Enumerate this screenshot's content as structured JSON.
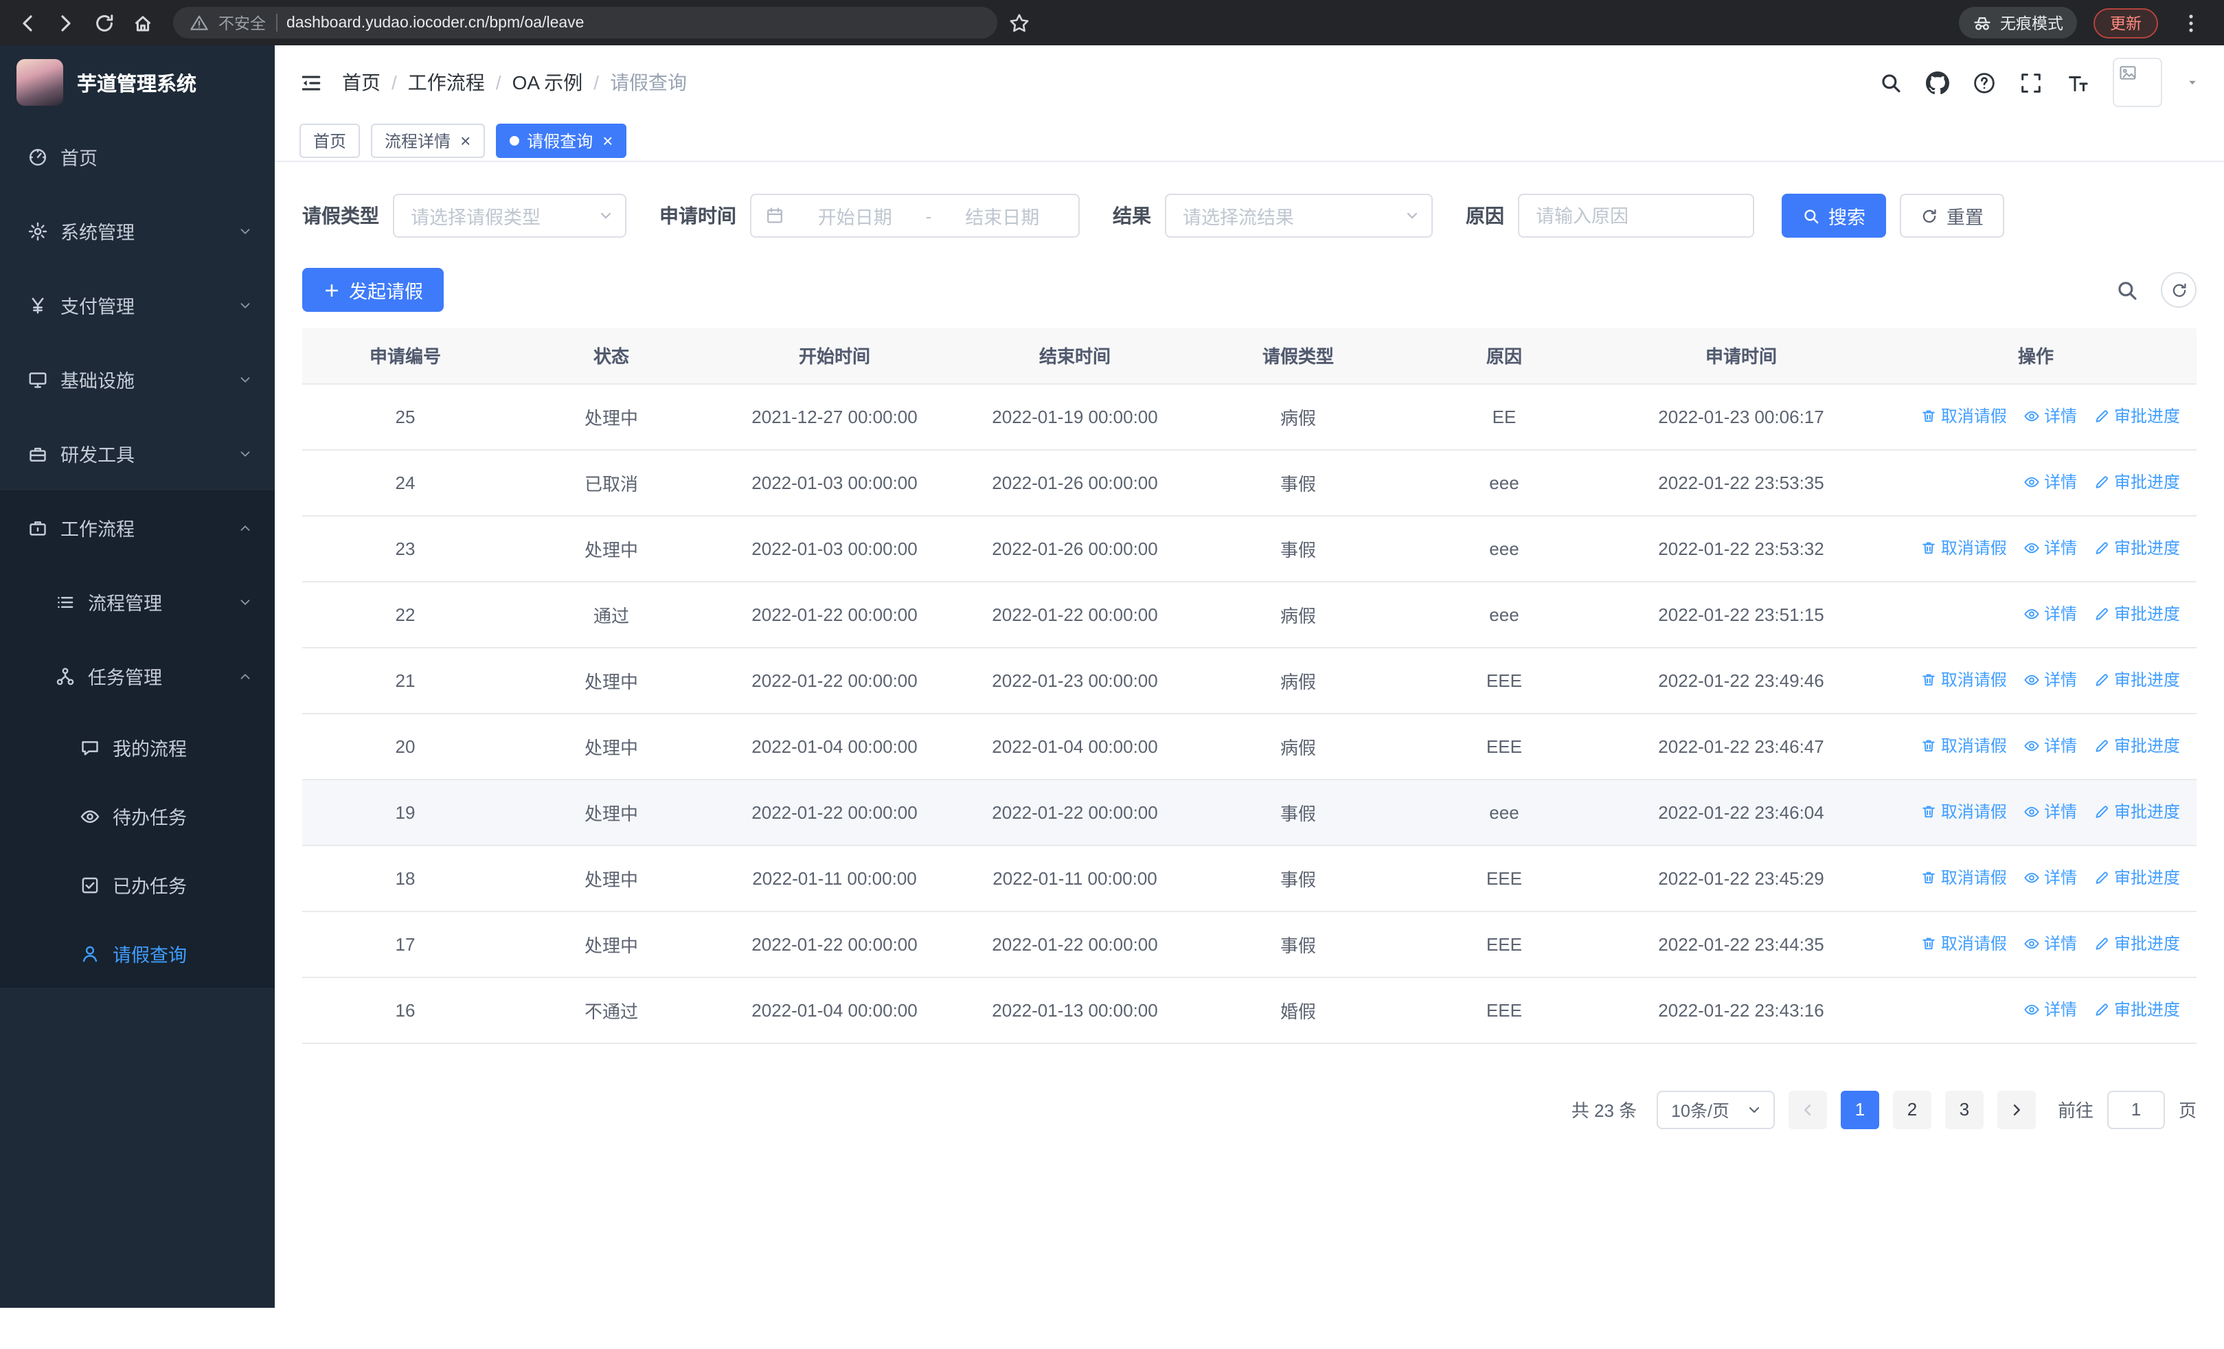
{
  "browser": {
    "security_warning": "不安全",
    "url": "dashboard.yudao.iocoder.cn/bpm/oa/leave",
    "incognito_label": "无痕模式",
    "update_label": "更新"
  },
  "sidebar": {
    "logo_title": "芋道管理系统",
    "menu": [
      {
        "key": "home",
        "icon": "dashboard",
        "label": "首页"
      },
      {
        "key": "system",
        "icon": "gear",
        "label": "系统管理",
        "arrow": "down"
      },
      {
        "key": "payment",
        "icon": "yen",
        "label": "支付管理",
        "arrow": "down"
      },
      {
        "key": "infrastructure",
        "icon": "infra",
        "label": "基础设施",
        "arrow": "down"
      },
      {
        "key": "devtools",
        "icon": "tools",
        "label": "研发工具",
        "arrow": "down"
      },
      {
        "key": "workflow",
        "icon": "workflow",
        "label": "工作流程",
        "arrow": "up",
        "open": true,
        "children": [
          {
            "key": "process-management",
            "icon": "process",
            "label": "流程管理",
            "arrow": "down"
          },
          {
            "key": "task-management",
            "icon": "org",
            "label": "任务管理",
            "arrow": "up",
            "open": true,
            "children": [
              {
                "key": "my-process",
                "icon": "chat",
                "label": "我的流程"
              },
              {
                "key": "todo-tasks",
                "icon": "eye",
                "label": "待办任务"
              },
              {
                "key": "done-tasks",
                "icon": "check-square",
                "label": "已办任务"
              },
              {
                "key": "leave-query",
                "icon": "user",
                "label": "请假查询",
                "active": true
              }
            ]
          }
        ]
      }
    ]
  },
  "header": {
    "breadcrumb": [
      "首页",
      "工作流程",
      "OA 示例",
      "请假查询"
    ],
    "separator": "/"
  },
  "tabs": [
    {
      "key": "home",
      "label": "首页",
      "closable": false,
      "active": false
    },
    {
      "key": "process-detail",
      "label": "流程详情",
      "closable": true,
      "active": false
    },
    {
      "key": "leave-query",
      "label": "请假查询",
      "closable": true,
      "active": true
    }
  ],
  "filters": {
    "leave_type_label": "请假类型",
    "leave_type_placeholder": "请选择请假类型",
    "apply_time_label": "申请时间",
    "start_date_placeholder": "开始日期",
    "range_separator": "-",
    "end_date_placeholder": "结束日期",
    "result_label": "结果",
    "result_placeholder": "请选择流结果",
    "reason_label": "原因",
    "reason_placeholder": "请输入原因",
    "search_button": "搜索",
    "reset_button": "重置"
  },
  "toolbar": {
    "create_button": "发起请假"
  },
  "table": {
    "columns": [
      "申请编号",
      "状态",
      "开始时间",
      "结束时间",
      "请假类型",
      "原因",
      "申请时间",
      "操作"
    ],
    "actions": {
      "cancel": "取消请假",
      "detail": "详情",
      "progress": "审批进度"
    },
    "rows": [
      {
        "id": "25",
        "status": "处理中",
        "start": "2021-12-27 00:00:00",
        "end": "2022-01-19 00:00:00",
        "type": "病假",
        "reason": "EE",
        "applied": "2022-01-23 00:06:17",
        "cancelable": true
      },
      {
        "id": "24",
        "status": "已取消",
        "start": "2022-01-03 00:00:00",
        "end": "2022-01-26 00:00:00",
        "type": "事假",
        "reason": "eee",
        "applied": "2022-01-22 23:53:35",
        "cancelable": false
      },
      {
        "id": "23",
        "status": "处理中",
        "start": "2022-01-03 00:00:00",
        "end": "2022-01-26 00:00:00",
        "type": "事假",
        "reason": "eee",
        "applied": "2022-01-22 23:53:32",
        "cancelable": true
      },
      {
        "id": "22",
        "status": "通过",
        "start": "2022-01-22 00:00:00",
        "end": "2022-01-22 00:00:00",
        "type": "病假",
        "reason": "eee",
        "applied": "2022-01-22 23:51:15",
        "cancelable": false
      },
      {
        "id": "21",
        "status": "处理中",
        "start": "2022-01-22 00:00:00",
        "end": "2022-01-23 00:00:00",
        "type": "病假",
        "reason": "EEE",
        "applied": "2022-01-22 23:49:46",
        "cancelable": true
      },
      {
        "id": "20",
        "status": "处理中",
        "start": "2022-01-04 00:00:00",
        "end": "2022-01-04 00:00:00",
        "type": "病假",
        "reason": "EEE",
        "applied": "2022-01-22 23:46:47",
        "cancelable": true
      },
      {
        "id": "19",
        "status": "处理中",
        "start": "2022-01-22 00:00:00",
        "end": "2022-01-22 00:00:00",
        "type": "事假",
        "reason": "eee",
        "applied": "2022-01-22 23:46:04",
        "cancelable": true,
        "highlight": true
      },
      {
        "id": "18",
        "status": "处理中",
        "start": "2022-01-11 00:00:00",
        "end": "2022-01-11 00:00:00",
        "type": "事假",
        "reason": "EEE",
        "applied": "2022-01-22 23:45:29",
        "cancelable": true
      },
      {
        "id": "17",
        "status": "处理中",
        "start": "2022-01-22 00:00:00",
        "end": "2022-01-22 00:00:00",
        "type": "事假",
        "reason": "EEE",
        "applied": "2022-01-22 23:44:35",
        "cancelable": true
      },
      {
        "id": "16",
        "status": "不通过",
        "start": "2022-01-04 00:00:00",
        "end": "2022-01-13 00:00:00",
        "type": "婚假",
        "reason": "EEE",
        "applied": "2022-01-22 23:43:16",
        "cancelable": false
      }
    ]
  },
  "pagination": {
    "total": "共 23 条",
    "page_size": "10条/页",
    "pages": [
      "1",
      "2",
      "3"
    ],
    "active_page": "1",
    "goto_label": "前往",
    "goto_value": "1",
    "page_suffix": "页"
  },
  "glyphs": {
    "close": "×"
  },
  "colors": {
    "accent": "#3e7bfa",
    "link": "#409eff",
    "sidebar_bg": "#1e2a38",
    "sidebar_sub_bg": "#17222e",
    "table_header_bg": "#f8f8f9"
  }
}
